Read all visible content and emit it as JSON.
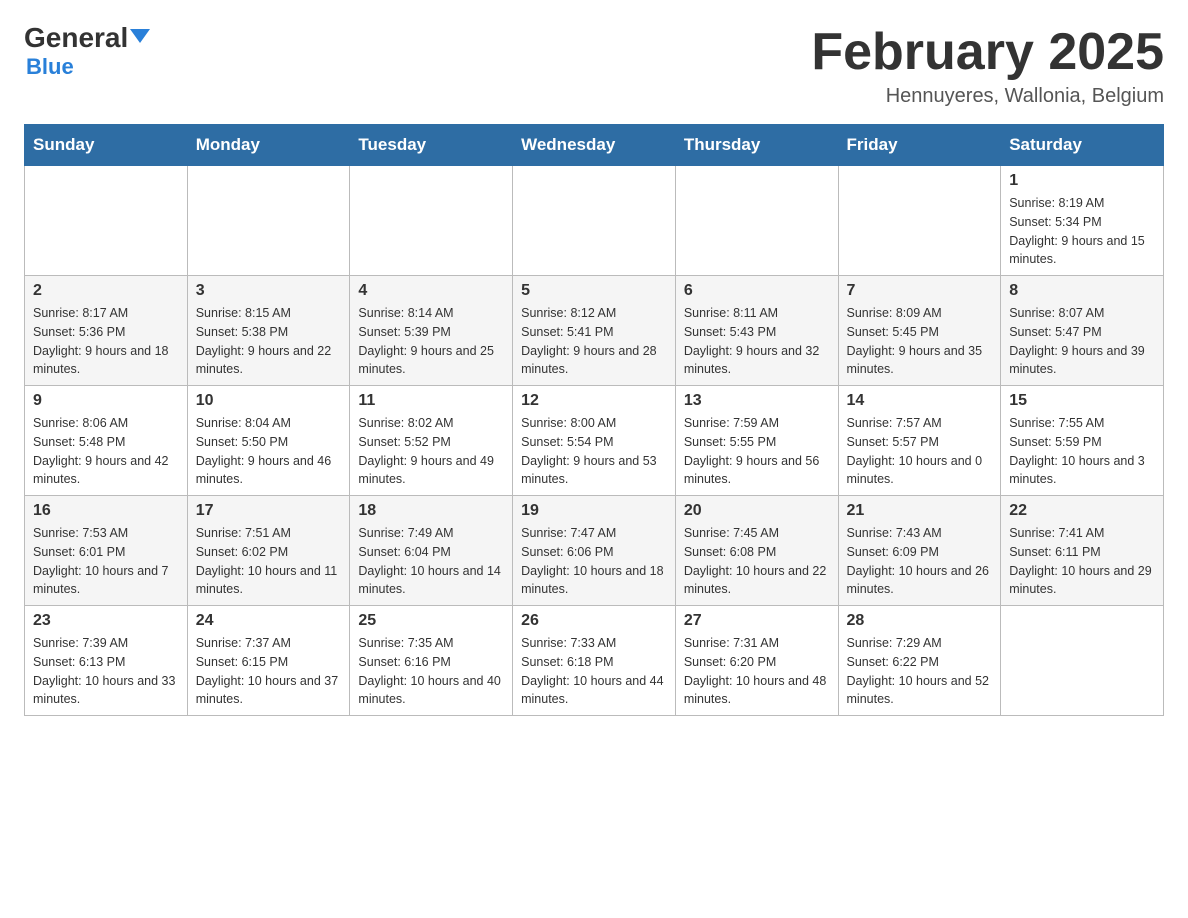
{
  "header": {
    "logo_main": "General",
    "logo_sub": "Blue",
    "month_title": "February 2025",
    "subtitle": "Hennuyeres, Wallonia, Belgium"
  },
  "days_of_week": [
    "Sunday",
    "Monday",
    "Tuesday",
    "Wednesday",
    "Thursday",
    "Friday",
    "Saturday"
  ],
  "weeks": [
    {
      "days": [
        {
          "date": "",
          "info": ""
        },
        {
          "date": "",
          "info": ""
        },
        {
          "date": "",
          "info": ""
        },
        {
          "date": "",
          "info": ""
        },
        {
          "date": "",
          "info": ""
        },
        {
          "date": "",
          "info": ""
        },
        {
          "date": "1",
          "info": "Sunrise: 8:19 AM\nSunset: 5:34 PM\nDaylight: 9 hours and 15 minutes."
        }
      ]
    },
    {
      "days": [
        {
          "date": "2",
          "info": "Sunrise: 8:17 AM\nSunset: 5:36 PM\nDaylight: 9 hours and 18 minutes."
        },
        {
          "date": "3",
          "info": "Sunrise: 8:15 AM\nSunset: 5:38 PM\nDaylight: 9 hours and 22 minutes."
        },
        {
          "date": "4",
          "info": "Sunrise: 8:14 AM\nSunset: 5:39 PM\nDaylight: 9 hours and 25 minutes."
        },
        {
          "date": "5",
          "info": "Sunrise: 8:12 AM\nSunset: 5:41 PM\nDaylight: 9 hours and 28 minutes."
        },
        {
          "date": "6",
          "info": "Sunrise: 8:11 AM\nSunset: 5:43 PM\nDaylight: 9 hours and 32 minutes."
        },
        {
          "date": "7",
          "info": "Sunrise: 8:09 AM\nSunset: 5:45 PM\nDaylight: 9 hours and 35 minutes."
        },
        {
          "date": "8",
          "info": "Sunrise: 8:07 AM\nSunset: 5:47 PM\nDaylight: 9 hours and 39 minutes."
        }
      ]
    },
    {
      "days": [
        {
          "date": "9",
          "info": "Sunrise: 8:06 AM\nSunset: 5:48 PM\nDaylight: 9 hours and 42 minutes."
        },
        {
          "date": "10",
          "info": "Sunrise: 8:04 AM\nSunset: 5:50 PM\nDaylight: 9 hours and 46 minutes."
        },
        {
          "date": "11",
          "info": "Sunrise: 8:02 AM\nSunset: 5:52 PM\nDaylight: 9 hours and 49 minutes."
        },
        {
          "date": "12",
          "info": "Sunrise: 8:00 AM\nSunset: 5:54 PM\nDaylight: 9 hours and 53 minutes."
        },
        {
          "date": "13",
          "info": "Sunrise: 7:59 AM\nSunset: 5:55 PM\nDaylight: 9 hours and 56 minutes."
        },
        {
          "date": "14",
          "info": "Sunrise: 7:57 AM\nSunset: 5:57 PM\nDaylight: 10 hours and 0 minutes."
        },
        {
          "date": "15",
          "info": "Sunrise: 7:55 AM\nSunset: 5:59 PM\nDaylight: 10 hours and 3 minutes."
        }
      ]
    },
    {
      "days": [
        {
          "date": "16",
          "info": "Sunrise: 7:53 AM\nSunset: 6:01 PM\nDaylight: 10 hours and 7 minutes."
        },
        {
          "date": "17",
          "info": "Sunrise: 7:51 AM\nSunset: 6:02 PM\nDaylight: 10 hours and 11 minutes."
        },
        {
          "date": "18",
          "info": "Sunrise: 7:49 AM\nSunset: 6:04 PM\nDaylight: 10 hours and 14 minutes."
        },
        {
          "date": "19",
          "info": "Sunrise: 7:47 AM\nSunset: 6:06 PM\nDaylight: 10 hours and 18 minutes."
        },
        {
          "date": "20",
          "info": "Sunrise: 7:45 AM\nSunset: 6:08 PM\nDaylight: 10 hours and 22 minutes."
        },
        {
          "date": "21",
          "info": "Sunrise: 7:43 AM\nSunset: 6:09 PM\nDaylight: 10 hours and 26 minutes."
        },
        {
          "date": "22",
          "info": "Sunrise: 7:41 AM\nSunset: 6:11 PM\nDaylight: 10 hours and 29 minutes."
        }
      ]
    },
    {
      "days": [
        {
          "date": "23",
          "info": "Sunrise: 7:39 AM\nSunset: 6:13 PM\nDaylight: 10 hours and 33 minutes."
        },
        {
          "date": "24",
          "info": "Sunrise: 7:37 AM\nSunset: 6:15 PM\nDaylight: 10 hours and 37 minutes."
        },
        {
          "date": "25",
          "info": "Sunrise: 7:35 AM\nSunset: 6:16 PM\nDaylight: 10 hours and 40 minutes."
        },
        {
          "date": "26",
          "info": "Sunrise: 7:33 AM\nSunset: 6:18 PM\nDaylight: 10 hours and 44 minutes."
        },
        {
          "date": "27",
          "info": "Sunrise: 7:31 AM\nSunset: 6:20 PM\nDaylight: 10 hours and 48 minutes."
        },
        {
          "date": "28",
          "info": "Sunrise: 7:29 AM\nSunset: 6:22 PM\nDaylight: 10 hours and 52 minutes."
        },
        {
          "date": "",
          "info": ""
        }
      ]
    }
  ]
}
